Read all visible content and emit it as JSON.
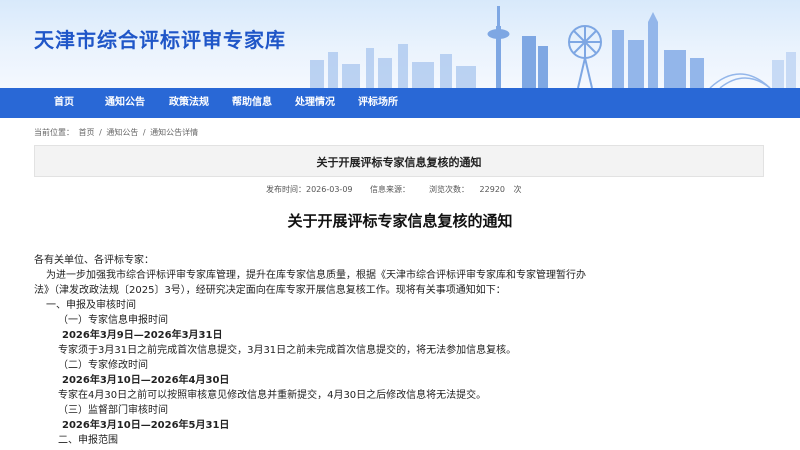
{
  "site": {
    "title": "天津市综合评标评审专家库"
  },
  "nav": {
    "items": [
      "首页",
      "通知公告",
      "政策法规",
      "帮助信息",
      "处理情况",
      "评标场所"
    ]
  },
  "breadcrumb": {
    "label": "当前位置：",
    "items": [
      "首页",
      "通知公告",
      "通知公告详情"
    ],
    "separator": "/"
  },
  "notice": {
    "box_title": "关于开展评标专家信息复核的通知",
    "publish_label": "发布时间：",
    "publish_date": "2026-03-09",
    "source_label": "信息来源：",
    "source_value": "",
    "views_label": "浏览次数：",
    "views_value": "22920",
    "views_unit": "次"
  },
  "article": {
    "title": "关于开展评标专家信息复核的通知",
    "lines": [
      "各有关单位、各评标专家：",
      "为进一步加强我市综合评标评审专家库管理，提升在库专家信息质量，根据《天津市综合评标评审专家库和专家管理暂行办",
      "法》（津发改政法规〔2025〕3号），经研究决定面向在库专家开展信息复核工作。现将有关事项通知如下：",
      "一、申报及审核时间",
      "（一）专家信息申报时间",
      "2026年3月9日—2026年3月31日",
      "专家须于3月31日之前完成首次信息提交，3月31日之前未完成首次信息提交的，将无法参加信息复核。",
      "（二）专家修改时间",
      "2026年3月10日—2026年4月30日",
      "专家在4月30日之前可以按照审核意见修改信息并重新提交，4月30日之后修改信息将无法提交。",
      "（三）监督部门审核时间",
      "2026年3月10日—2026年5月31日",
      "二、申报范围"
    ]
  },
  "colors": {
    "nav_bg": "#2968d6",
    "title_blue": "#1f56c8",
    "banner_bg": "#e3effc"
  }
}
